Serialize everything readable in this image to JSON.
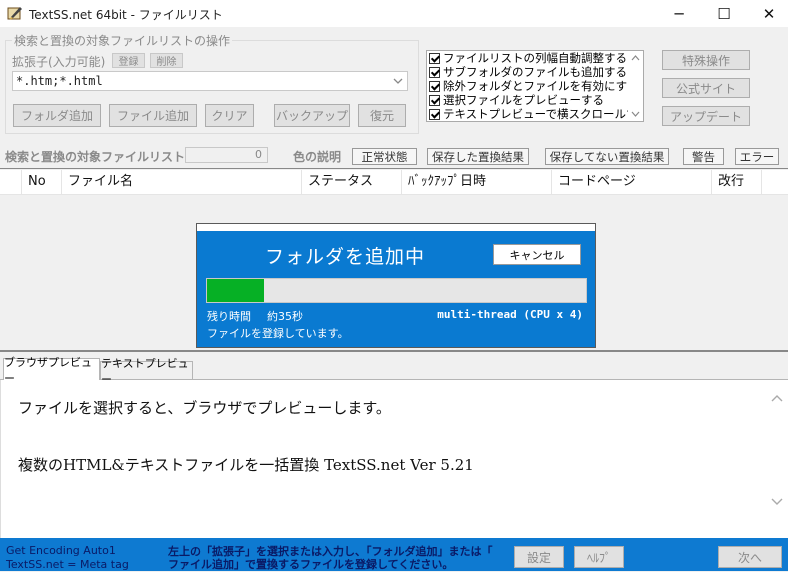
{
  "window": {
    "title": "TextSS.net 64bit - ファイルリスト",
    "minimize": "─",
    "maximize": "☐",
    "close": "✕"
  },
  "operations": {
    "group_title": "検索と置換の対象ファイルリストの操作",
    "ext_label": "拡張子(入力可能)",
    "register_btn": "登録",
    "delete_btn": "削除",
    "ext_value": "*.htm;*.html",
    "add_folder_btn": "フォルダ追加",
    "add_file_btn": "ファイル追加",
    "clear_btn": "クリア",
    "backup_btn": "バックアップ",
    "restore_btn": "復元"
  },
  "options": [
    {
      "label": "ファイルリストの列幅自動調整する",
      "checked": true
    },
    {
      "label": "サブフォルダのファイルも追加する",
      "checked": true
    },
    {
      "label": "除外フォルダとファイルを有効にする",
      "checked": true
    },
    {
      "label": "選択ファイルをプレビューする",
      "checked": true
    },
    {
      "label": "テキストプレビューで横スクロールする",
      "checked": true
    }
  ],
  "side_buttons": {
    "special": "特殊操作",
    "official_site": "公式サイト",
    "update": "アップデート"
  },
  "legend": {
    "list_label": "検索と置換の対象ファイルリスト",
    "count": "0",
    "color_label": "色の説明",
    "normal": "正常状態",
    "saved": "保存した置換結果",
    "unsaved": "保存してない置換結果",
    "warning": "警告",
    "error": "エラー"
  },
  "table": {
    "columns": [
      "No",
      "ファイル名",
      "ステータス",
      "ﾊﾞｯｸｱｯﾌﾟ日時",
      "コードページ",
      "改行"
    ]
  },
  "dialog": {
    "title": "フォルダを追加中",
    "cancel": "キャンセル",
    "progress": 0.15,
    "remaining_label": "残り時間",
    "remaining_value": "約35秒",
    "thread_info": "multi-thread (CPU x 4)",
    "status": "ファイルを登録しています。"
  },
  "preview": {
    "tab_browser": "ブラウザプレビュー",
    "tab_text": "テキストプレビュー",
    "line1": "ファイルを選択すると、ブラウザでプレビューします。",
    "line2": "複数のHTML&テキストファイルを一括置換 TextSS.net Ver 5.21"
  },
  "statusbar": {
    "encoding": "Get Encoding Auto1",
    "meta": "TextSS.net = Meta tag",
    "hint_line1": "左上の「拡張子」を選択または入力し、「フォルダ追加」または「",
    "hint_line2": "ファイル追加」で置換するファイルを登録してください。",
    "settings": "設定",
    "help": "ﾍﾙﾌﾟ",
    "next": "次へ"
  },
  "colors": {
    "dialog_blue": "#0a7ad1",
    "progress_green": "#06b025",
    "status_blue": "#0e7ad1"
  }
}
